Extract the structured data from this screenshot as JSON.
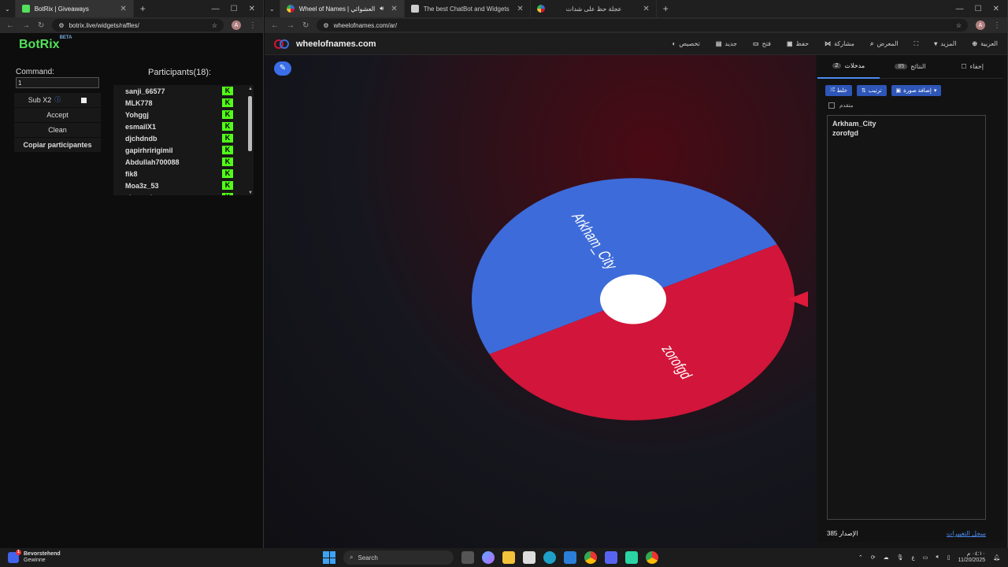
{
  "left_window": {
    "tab_title": "BotRix | Giveaways",
    "url": "botrix.live/widgets/raffles/",
    "avatar_letter": "A",
    "logo": "BotRix",
    "logo_badge": "BETA",
    "command_label": "Command:",
    "command_value": "1",
    "sub_label": "Sub X2",
    "accept_label": "Accept",
    "clean_label": "Clean",
    "copy_label": "Copiar participantes",
    "participants_title": "Participants(18):",
    "participants": [
      "sanji_66577",
      "MLK778",
      "Yohggj",
      "esmailX1",
      "djchdndb",
      "gapirhririgimil",
      "Abdullah700088",
      "fik8",
      "Moa3z_53",
      "siqspcd"
    ],
    "kick_icon_letter": "K"
  },
  "right_window": {
    "tabs": [
      {
        "title": "Wheel of Names | العشوائي"
      },
      {
        "title": "The best ChatBot and Widgets"
      },
      {
        "title": "عجلة حظ على شدات"
      }
    ],
    "url": "wheelofnames.com/ar/",
    "avatar_letter": "A",
    "site_name": "wheelofnames.com",
    "menu": {
      "customize": "تخصيص",
      "new": "جديد",
      "open": "فتح",
      "save": "حفظ",
      "share": "مشاركة",
      "gallery": "المعرض",
      "more": "المزيد",
      "language": "العربية"
    },
    "wheel": {
      "segments": [
        {
          "label": "Arkham_City",
          "color": "#3d6bd9"
        },
        {
          "label": "zorofgd",
          "color": "#d2153a"
        }
      ]
    },
    "panel": {
      "hide_label": "إخفاء",
      "results_label": "النتائج",
      "results_count": "85",
      "entries_label": "مدخلات",
      "entries_count": "2",
      "shuffle_label": "خلط",
      "sort_label": "ترتيب",
      "add_image_label": "إضافة صورة",
      "advanced_label": "متقدم",
      "entries": [
        "Arkham_City",
        "zorofgd"
      ],
      "version": "385 الإصدار",
      "changelog": "سجل التغييرات"
    }
  },
  "taskbar": {
    "notif_title": "Bevorstehend",
    "notif_sub": "Gewinne",
    "search_placeholder": "Search",
    "lang": "ع",
    "time": "٠٤:١٠ م",
    "date": "11/20/2025"
  }
}
